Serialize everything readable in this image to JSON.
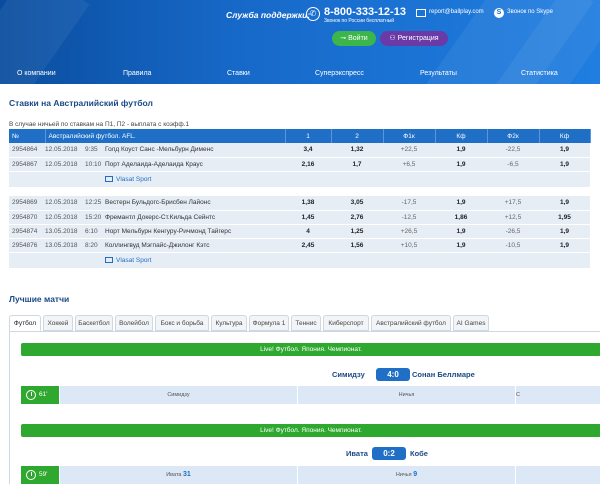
{
  "header": {
    "support_label": "Служба поддержки:",
    "phone": "8-800-333-12-13",
    "phone_sub": "Звонок по России бесплатный",
    "email": "report@ballplay.com",
    "skype": "Звонок по Skype",
    "login": "Войти",
    "register": "Регистрация",
    "nav": [
      "О компании",
      "Правила",
      "Ставки",
      "Суперэкспресс",
      "Результаты",
      "Статистика"
    ]
  },
  "odds_section": {
    "title": "Ставки на Австралийский футбол",
    "note": "В случае ничьей по ставкам на П1, П2 - выплата с коэфф.1",
    "columns": [
      "№",
      "Австралийский футбол. AFL.",
      "1",
      "2",
      "Ф1к",
      "Кф",
      "Ф2к",
      "Кф"
    ],
    "tv_label": "Vlasat Sport",
    "rows": [
      {
        "id": "2954864",
        "date": "12.05.2018",
        "time": "9:35",
        "match": "Голд Коуст Санс -Мельбурн Дименс",
        "o1": "3,4",
        "o2": "1,32",
        "f1": "+22,5",
        "k1": "1,9",
        "f2": "-22,5",
        "k2": "1,9"
      },
      {
        "id": "2954867",
        "date": "12.05.2018",
        "time": "10:10",
        "match": "Порт Аделаида-Аделаида Краус",
        "o1": "2,16",
        "o2": "1,7",
        "f1": "+6,5",
        "k1": "1,9",
        "f2": "-6,5",
        "k2": "1,9"
      },
      {
        "id": "2954869",
        "date": "12.05.2018",
        "time": "12:25",
        "match": "Вестерн Бульдогс-Брисбен Лайонс",
        "o1": "1,38",
        "o2": "3,05",
        "f1": "-17,5",
        "k1": "1,9",
        "f2": "+17,5",
        "k2": "1,9"
      },
      {
        "id": "2954870",
        "date": "12.05.2018",
        "time": "15:20",
        "match": "Фремантл Докерс-Ст.Кильда Сейнтс",
        "o1": "1,45",
        "o2": "2,76",
        "f1": "-12,5",
        "k1": "1,86",
        "f2": "+12,5",
        "k2": "1,95"
      },
      {
        "id": "2954874",
        "date": "13.05.2018",
        "time": "6:10",
        "match": "Норт Мельбурн Кенгуру-Ричмонд Тайгерс",
        "o1": "4",
        "o2": "1,25",
        "f1": "+26,5",
        "k1": "1,9",
        "f2": "-26,5",
        "k2": "1,9"
      },
      {
        "id": "2954876",
        "date": "13.05.2018",
        "time": "8:20",
        "match": "Коллингвуд Мэгпайс-Джилонг Кэтс",
        "o1": "2,45",
        "o2": "1,56",
        "f1": "+10,5",
        "k1": "1,9",
        "f2": "-10,5",
        "k2": "1,9"
      }
    ]
  },
  "best": {
    "title": "Лучшие матчи",
    "tabs": [
      "Футбол",
      "Хоккей",
      "Баскетбол",
      "Волейбол",
      "Бокс и борьба",
      "Культура",
      "Формула 1",
      "Теннис",
      "Киберспорт",
      "Австралийский футбол",
      "AI Games"
    ],
    "matches": [
      {
        "league": "Live! Футбол. Япония. Чемпионат.",
        "home": "Симидзу",
        "score": "4:0",
        "away": "Сонан Беллмаре",
        "minute": "61'",
        "c1": "Симидзу",
        "c1v": "",
        "c2": "Ничья",
        "c2v": "",
        "c3": "С",
        "c3v": ""
      },
      {
        "league": "Live! Футбол. Япония. Чемпионат.",
        "home": "Ивата",
        "score": "0:2",
        "away": "Кобе",
        "minute": "59'",
        "c1": "Ивата",
        "c1v": "31",
        "c2": "Ничья",
        "c2v": "9",
        "c3": "",
        "c3v": ""
      }
    ]
  }
}
